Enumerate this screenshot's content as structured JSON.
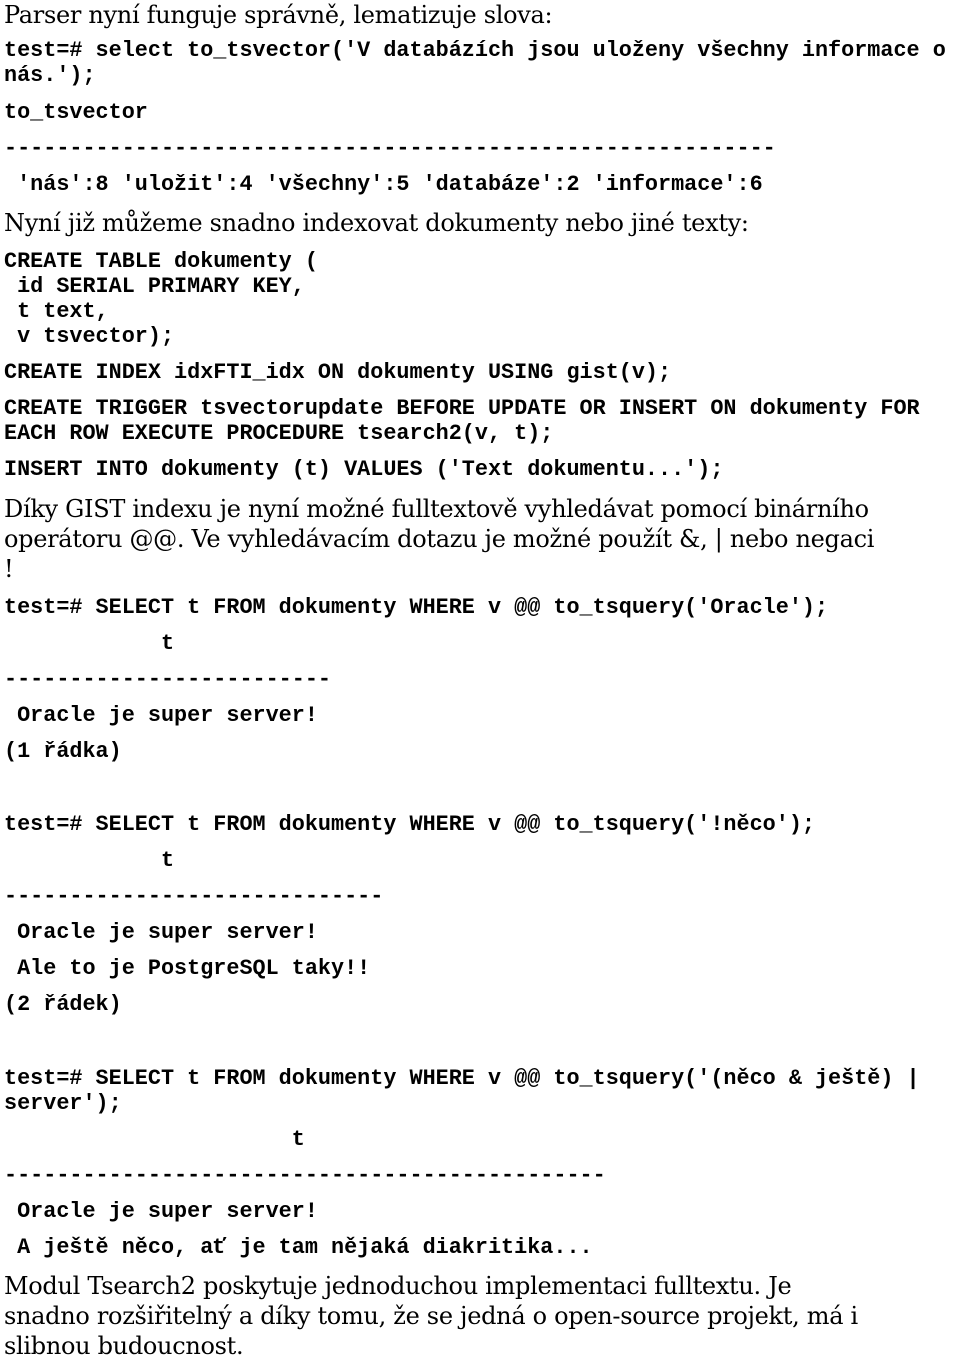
{
  "paragraphs": {
    "p1": "Parser nyní funguje správně, lematizuje slova:",
    "p2": "Nyní již můžeme snadno indexovat dokumenty nebo jiné texty:",
    "p3_line1": "Díky GIST indexu je nyní možné fulltextově vyhledávat pomocí binárního",
    "p3_line2": "operátoru @@. Ve vyhledávacím dotazu je možné použít &, | nebo negaci",
    "p3_line3": "!",
    "p4_line1": "Modul Tsearch2 poskytuje jednoduchou implementaci fulltextu. Je",
    "p4_line2": "snadno rozšiřitelný a díky tomu, že se jedná o open-source projekt, má i",
    "p4_line3": "slibnou budoucnost."
  },
  "tsvector_example": {
    "query_line1": "test=# select to_tsvector('V databázích jsou uloženy všechny informace o",
    "query_line2": "nás.');",
    "column_header": "to_tsvector",
    "separator": "-----------------------------------------------------------",
    "result": " 'nás':8 'uložit':4 'všechny':5 'databáze':2 'informace':6"
  },
  "schema": {
    "create_table_line1": "CREATE TABLE dokumenty (",
    "create_table_line2": " id SERIAL PRIMARY KEY,",
    "create_table_line3": " t text,",
    "create_table_line4": " v tsvector);",
    "create_index": "CREATE INDEX idxFTI_idx ON dokumenty USING gist(v);",
    "create_trigger_line1": "CREATE TRIGGER tsvectorupdate BEFORE UPDATE OR INSERT ON dokumenty FOR",
    "create_trigger_line2": "EACH ROW EXECUTE PROCEDURE tsearch2(v, t);",
    "insert": "INSERT INTO dokumenty (t) VALUES ('Text dokumentu...');"
  },
  "query1": {
    "command": "test=# SELECT t FROM dokumenty WHERE v @@ to_tsquery('Oracle');",
    "column_header": "            t",
    "separator": "-------------------------",
    "rows": [
      " Oracle je super server!"
    ],
    "row_count": "(1 řádka)"
  },
  "query2": {
    "command": "test=# SELECT t FROM dokumenty WHERE v @@ to_tsquery('!něco');",
    "column_header": "            t",
    "separator": "-----------------------------",
    "rows": [
      " Oracle je super server!",
      " Ale to je PostgreSQL taky!!"
    ],
    "row_count": "(2 řádek)"
  },
  "query3": {
    "command_line1": "test=# SELECT t FROM dokumenty WHERE v @@ to_tsquery('(něco & ještě) |",
    "command_line2": "server');",
    "column_header": "                      t",
    "separator": "----------------------------------------------",
    "rows": [
      " Oracle je super server!",
      " A ještě něco, ať je tam nějaká diakritika..."
    ]
  }
}
